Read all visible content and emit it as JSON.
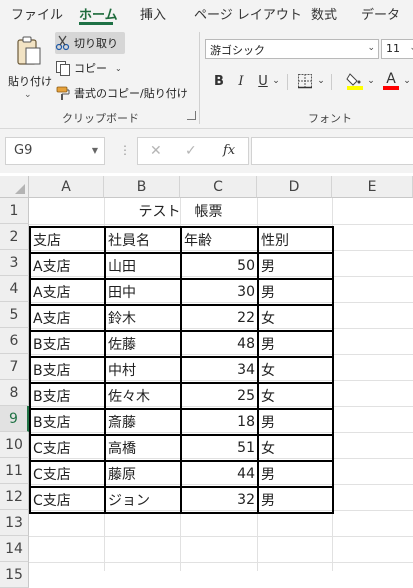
{
  "ribbon": {
    "tabs": [
      "ファイル",
      "ホーム",
      "挿入",
      "ページ レイアウト",
      "数式",
      "データ"
    ],
    "active_tab": "ホーム",
    "clipboard": {
      "paste_label": "貼り付け",
      "cut_label": "切り取り",
      "copy_label": "コピー",
      "format_painter_label": "書式のコピー/貼り付け",
      "group_label": "クリップボード"
    },
    "font": {
      "font_name": "游ゴシック",
      "font_size": "11",
      "bold": "B",
      "italic": "I",
      "underline": "U",
      "font_color_glyph": "A",
      "group_label": "フォント",
      "fill_color": "#ffff00",
      "text_color": "#ff0000"
    }
  },
  "formula_bar": {
    "name_box": "G9",
    "cancel_icon": "✕",
    "enter_icon": "✓",
    "fx_label": "fx",
    "formula": ""
  },
  "sheet": {
    "columns": [
      "A",
      "B",
      "C",
      "D",
      "E"
    ],
    "rows": [
      "1",
      "2",
      "3",
      "4",
      "5",
      "6",
      "7",
      "8",
      "9",
      "10",
      "11",
      "12",
      "13",
      "14",
      "15"
    ],
    "active_row": "9",
    "title": "テスト　帳票",
    "table": {
      "headers": [
        "支店",
        "社員名",
        "年齢",
        "性別"
      ],
      "rows": [
        [
          "A支店",
          "山田",
          "50",
          "男"
        ],
        [
          "A支店",
          "田中",
          "30",
          "男"
        ],
        [
          "A支店",
          "鈴木",
          "22",
          "女"
        ],
        [
          "B支店",
          "佐藤",
          "48",
          "男"
        ],
        [
          "B支店",
          "中村",
          "34",
          "女"
        ],
        [
          "B支店",
          "佐々木",
          "25",
          "女"
        ],
        [
          "B支店",
          "斎藤",
          "18",
          "男"
        ],
        [
          "C支店",
          "高橋",
          "51",
          "女"
        ],
        [
          "C支店",
          "藤原",
          "44",
          "男"
        ],
        [
          "C支店",
          "ジョン",
          "32",
          "男"
        ]
      ]
    }
  },
  "colors": {
    "accent": "#217346",
    "header_bg": "#efefef",
    "ribbon_bg": "#f3f3f3"
  }
}
